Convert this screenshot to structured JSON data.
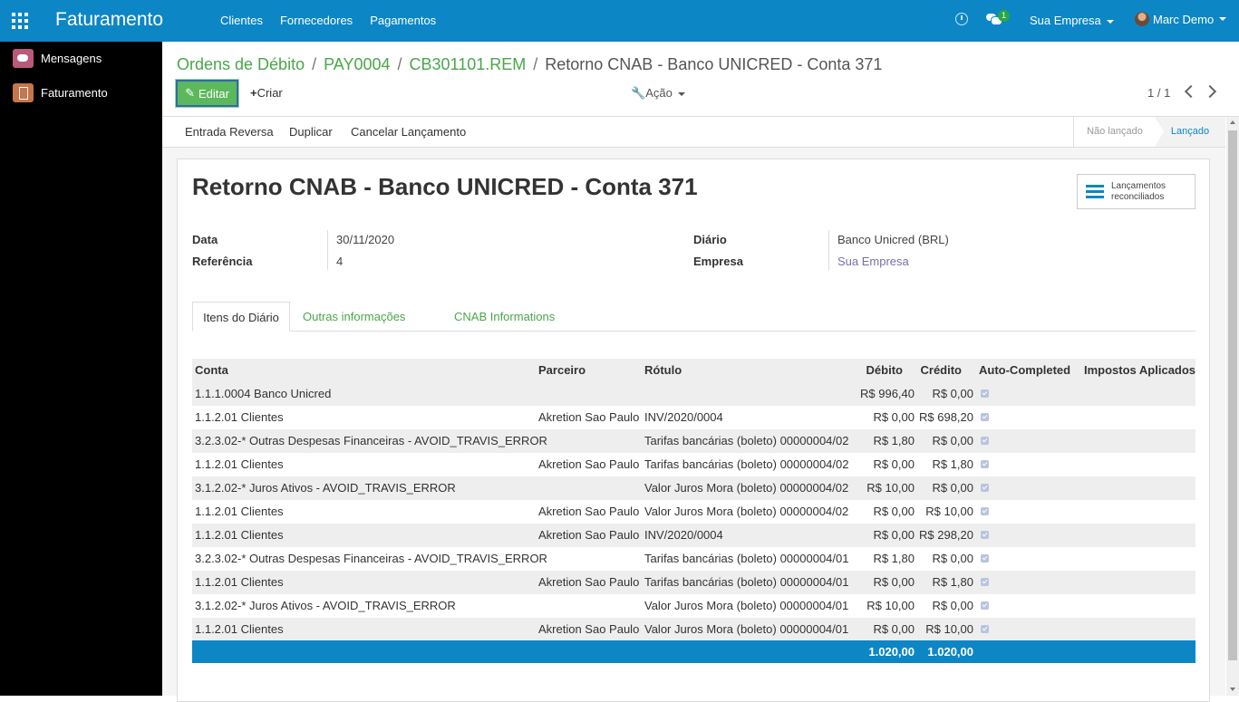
{
  "topbar": {
    "brand": "Faturamento",
    "menu": [
      "Clientes",
      "Fornecedores",
      "Pagamentos"
    ],
    "chat_badge": "1",
    "company": "Sua Empresa",
    "user": "Marc Demo"
  },
  "sidebar": {
    "items": [
      {
        "label": "Mensagens",
        "icon": "messages-icon"
      },
      {
        "label": "Faturamento",
        "icon": "invoicing-icon"
      }
    ]
  },
  "breadcrumb": {
    "items": [
      "Ordens de Débito",
      "PAY0004",
      "CB301101.REM"
    ],
    "current": "Retorno CNAB - Banco UNICRED - Conta 371"
  },
  "buttons": {
    "edit": "Editar",
    "create": "Criar",
    "action": "Ação"
  },
  "pager": "1 / 1",
  "statusbar": {
    "buttons": [
      "Entrada Reversa",
      "Duplicar",
      "Cancelar Lançamento"
    ],
    "stages": [
      "Não lançado",
      "Lançado"
    ],
    "active_stage": "Lançado"
  },
  "form": {
    "title": "Retorno CNAB - Banco UNICRED - Conta 371",
    "smart_button": [
      "Lançamentos",
      "reconciliados"
    ],
    "fields": {
      "data_label": "Data",
      "data_value": "30/11/2020",
      "ref_label": "Referência",
      "ref_value": "4",
      "diario_label": "Diário",
      "diario_value": "Banco Unicred (BRL)",
      "empresa_label": "Empresa",
      "empresa_value": "Sua Empresa"
    },
    "tabs": [
      "Itens do Diário",
      "Outras informações",
      "CNAB Informations"
    ]
  },
  "table": {
    "headers": [
      "Conta",
      "Parceiro",
      "Rótulo",
      "Débito",
      "Crédito",
      "Auto-Completed",
      "Impostos Aplicados"
    ],
    "rows": [
      {
        "conta": "1.1.1.0004 Banco Unicred",
        "parceiro": "",
        "rotulo": "",
        "debito": "R$ 996,40",
        "credito": "R$ 0,00",
        "auto": true
      },
      {
        "conta": "1.1.2.01 Clientes",
        "parceiro": "Akretion Sao Paulo",
        "rotulo": "INV/2020/0004",
        "debito": "R$ 0,00",
        "credito": "R$ 698,20",
        "auto": true
      },
      {
        "conta": "3.2.3.02-* Outras Despesas Financeiras - AVOID_TRAVIS_ERROR",
        "parceiro": "",
        "rotulo": "Tarifas bancárias (boleto) 00000004/02",
        "debito": "R$ 1,80",
        "credito": "R$ 0,00",
        "auto": true
      },
      {
        "conta": "1.1.2.01 Clientes",
        "parceiro": "Akretion Sao Paulo",
        "rotulo": "Tarifas bancárias (boleto) 00000004/02",
        "debito": "R$ 0,00",
        "credito": "R$ 1,80",
        "auto": true
      },
      {
        "conta": "3.1.2.02-* Juros Ativos - AVOID_TRAVIS_ERROR",
        "parceiro": "",
        "rotulo": "Valor Juros Mora (boleto) 00000004/02",
        "debito": "R$ 10,00",
        "credito": "R$ 0,00",
        "auto": true
      },
      {
        "conta": "1.1.2.01 Clientes",
        "parceiro": "Akretion Sao Paulo",
        "rotulo": "Valor Juros Mora (boleto) 00000004/02",
        "debito": "R$ 0,00",
        "credito": "R$ 10,00",
        "auto": true
      },
      {
        "conta": "1.1.2.01 Clientes",
        "parceiro": "Akretion Sao Paulo",
        "rotulo": "INV/2020/0004",
        "debito": "R$ 0,00",
        "credito": "R$ 298,20",
        "auto": true
      },
      {
        "conta": "3.2.3.02-* Outras Despesas Financeiras - AVOID_TRAVIS_ERROR",
        "parceiro": "",
        "rotulo": "Tarifas bancárias (boleto) 00000004/01",
        "debito": "R$ 1,80",
        "credito": "R$ 0,00",
        "auto": true
      },
      {
        "conta": "1.1.2.01 Clientes",
        "parceiro": "Akretion Sao Paulo",
        "rotulo": "Tarifas bancárias (boleto) 00000004/01",
        "debito": "R$ 0,00",
        "credito": "R$ 1,80",
        "auto": true
      },
      {
        "conta": "3.1.2.02-* Juros Ativos - AVOID_TRAVIS_ERROR",
        "parceiro": "",
        "rotulo": "Valor Juros Mora (boleto) 00000004/01",
        "debito": "R$ 10,00",
        "credito": "R$ 0,00",
        "auto": true
      },
      {
        "conta": "1.1.2.01 Clientes",
        "parceiro": "Akretion Sao Paulo",
        "rotulo": "Valor Juros Mora (boleto) 00000004/01",
        "debito": "R$ 0,00",
        "credito": "R$ 10,00",
        "auto": true
      }
    ],
    "totals": {
      "debito": "1.020,00",
      "credito": "1.020,00"
    }
  },
  "colors": {
    "navbar": "#0d86c6",
    "link_green": "#4aa64a",
    "edit_button": "#5cb85c"
  }
}
